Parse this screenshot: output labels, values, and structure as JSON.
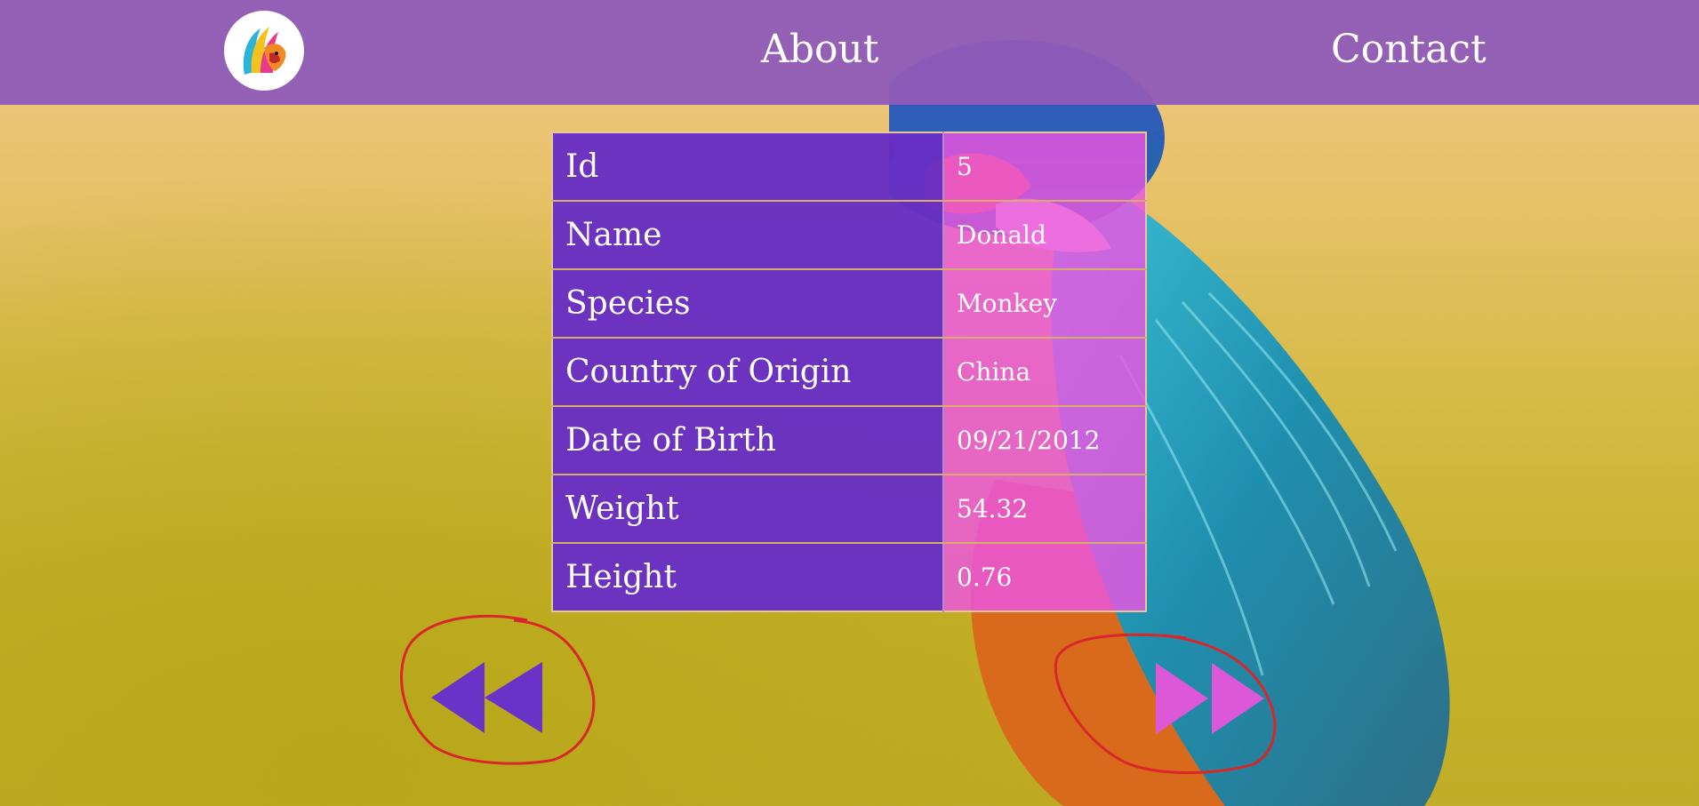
{
  "nav": {
    "logo_icon": "colorful-lion-head-logo",
    "links": [
      {
        "label": "About"
      },
      {
        "label": "Contact"
      }
    ]
  },
  "record": {
    "rows": [
      {
        "label": "Id",
        "value": "5"
      },
      {
        "label": "Name",
        "value": "Donald"
      },
      {
        "label": "Species",
        "value": "Monkey"
      },
      {
        "label": "Country of Origin",
        "value": "China"
      },
      {
        "label": "Date of Birth",
        "value": "09/21/2012"
      },
      {
        "label": "Weight",
        "value": "54.32"
      },
      {
        "label": "Height",
        "value": "0.76"
      }
    ]
  },
  "controls": {
    "previous_icon": "rewind-double-left-icon",
    "next_icon": "fast-forward-double-right-icon",
    "annotation": "red-hand-drawn-circle"
  },
  "colors": {
    "navbar": "#8f5cb8",
    "label_cell": "#682ec4",
    "value_cell": "#ec54e2",
    "previous_arrow": "#6a33c8",
    "next_arrow": "#dc58d8",
    "annotation": "#d8262a"
  }
}
